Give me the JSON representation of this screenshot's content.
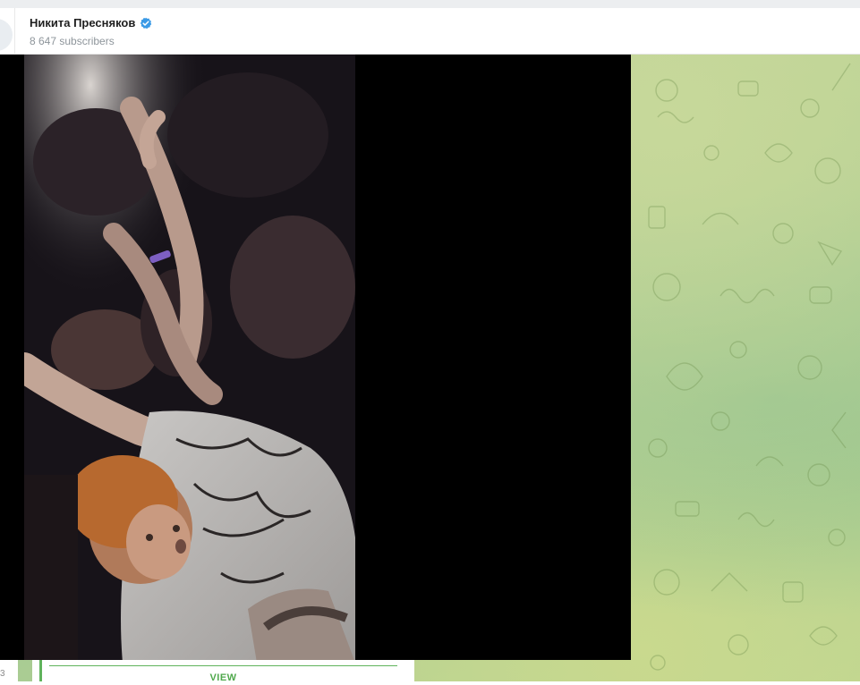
{
  "header": {
    "channel_name": "Никита Пресняков",
    "subscribers": "8 647 subscribers",
    "verified": true
  },
  "message": {
    "view_button_label": "VIEW"
  },
  "left_panel": {
    "partial_text": "3"
  },
  "video": {
    "scene": "concert crowd"
  },
  "colors": {
    "accent_green": "#5fb35c",
    "verified_blue": "#3a9ae6",
    "video_background": "#000000"
  }
}
